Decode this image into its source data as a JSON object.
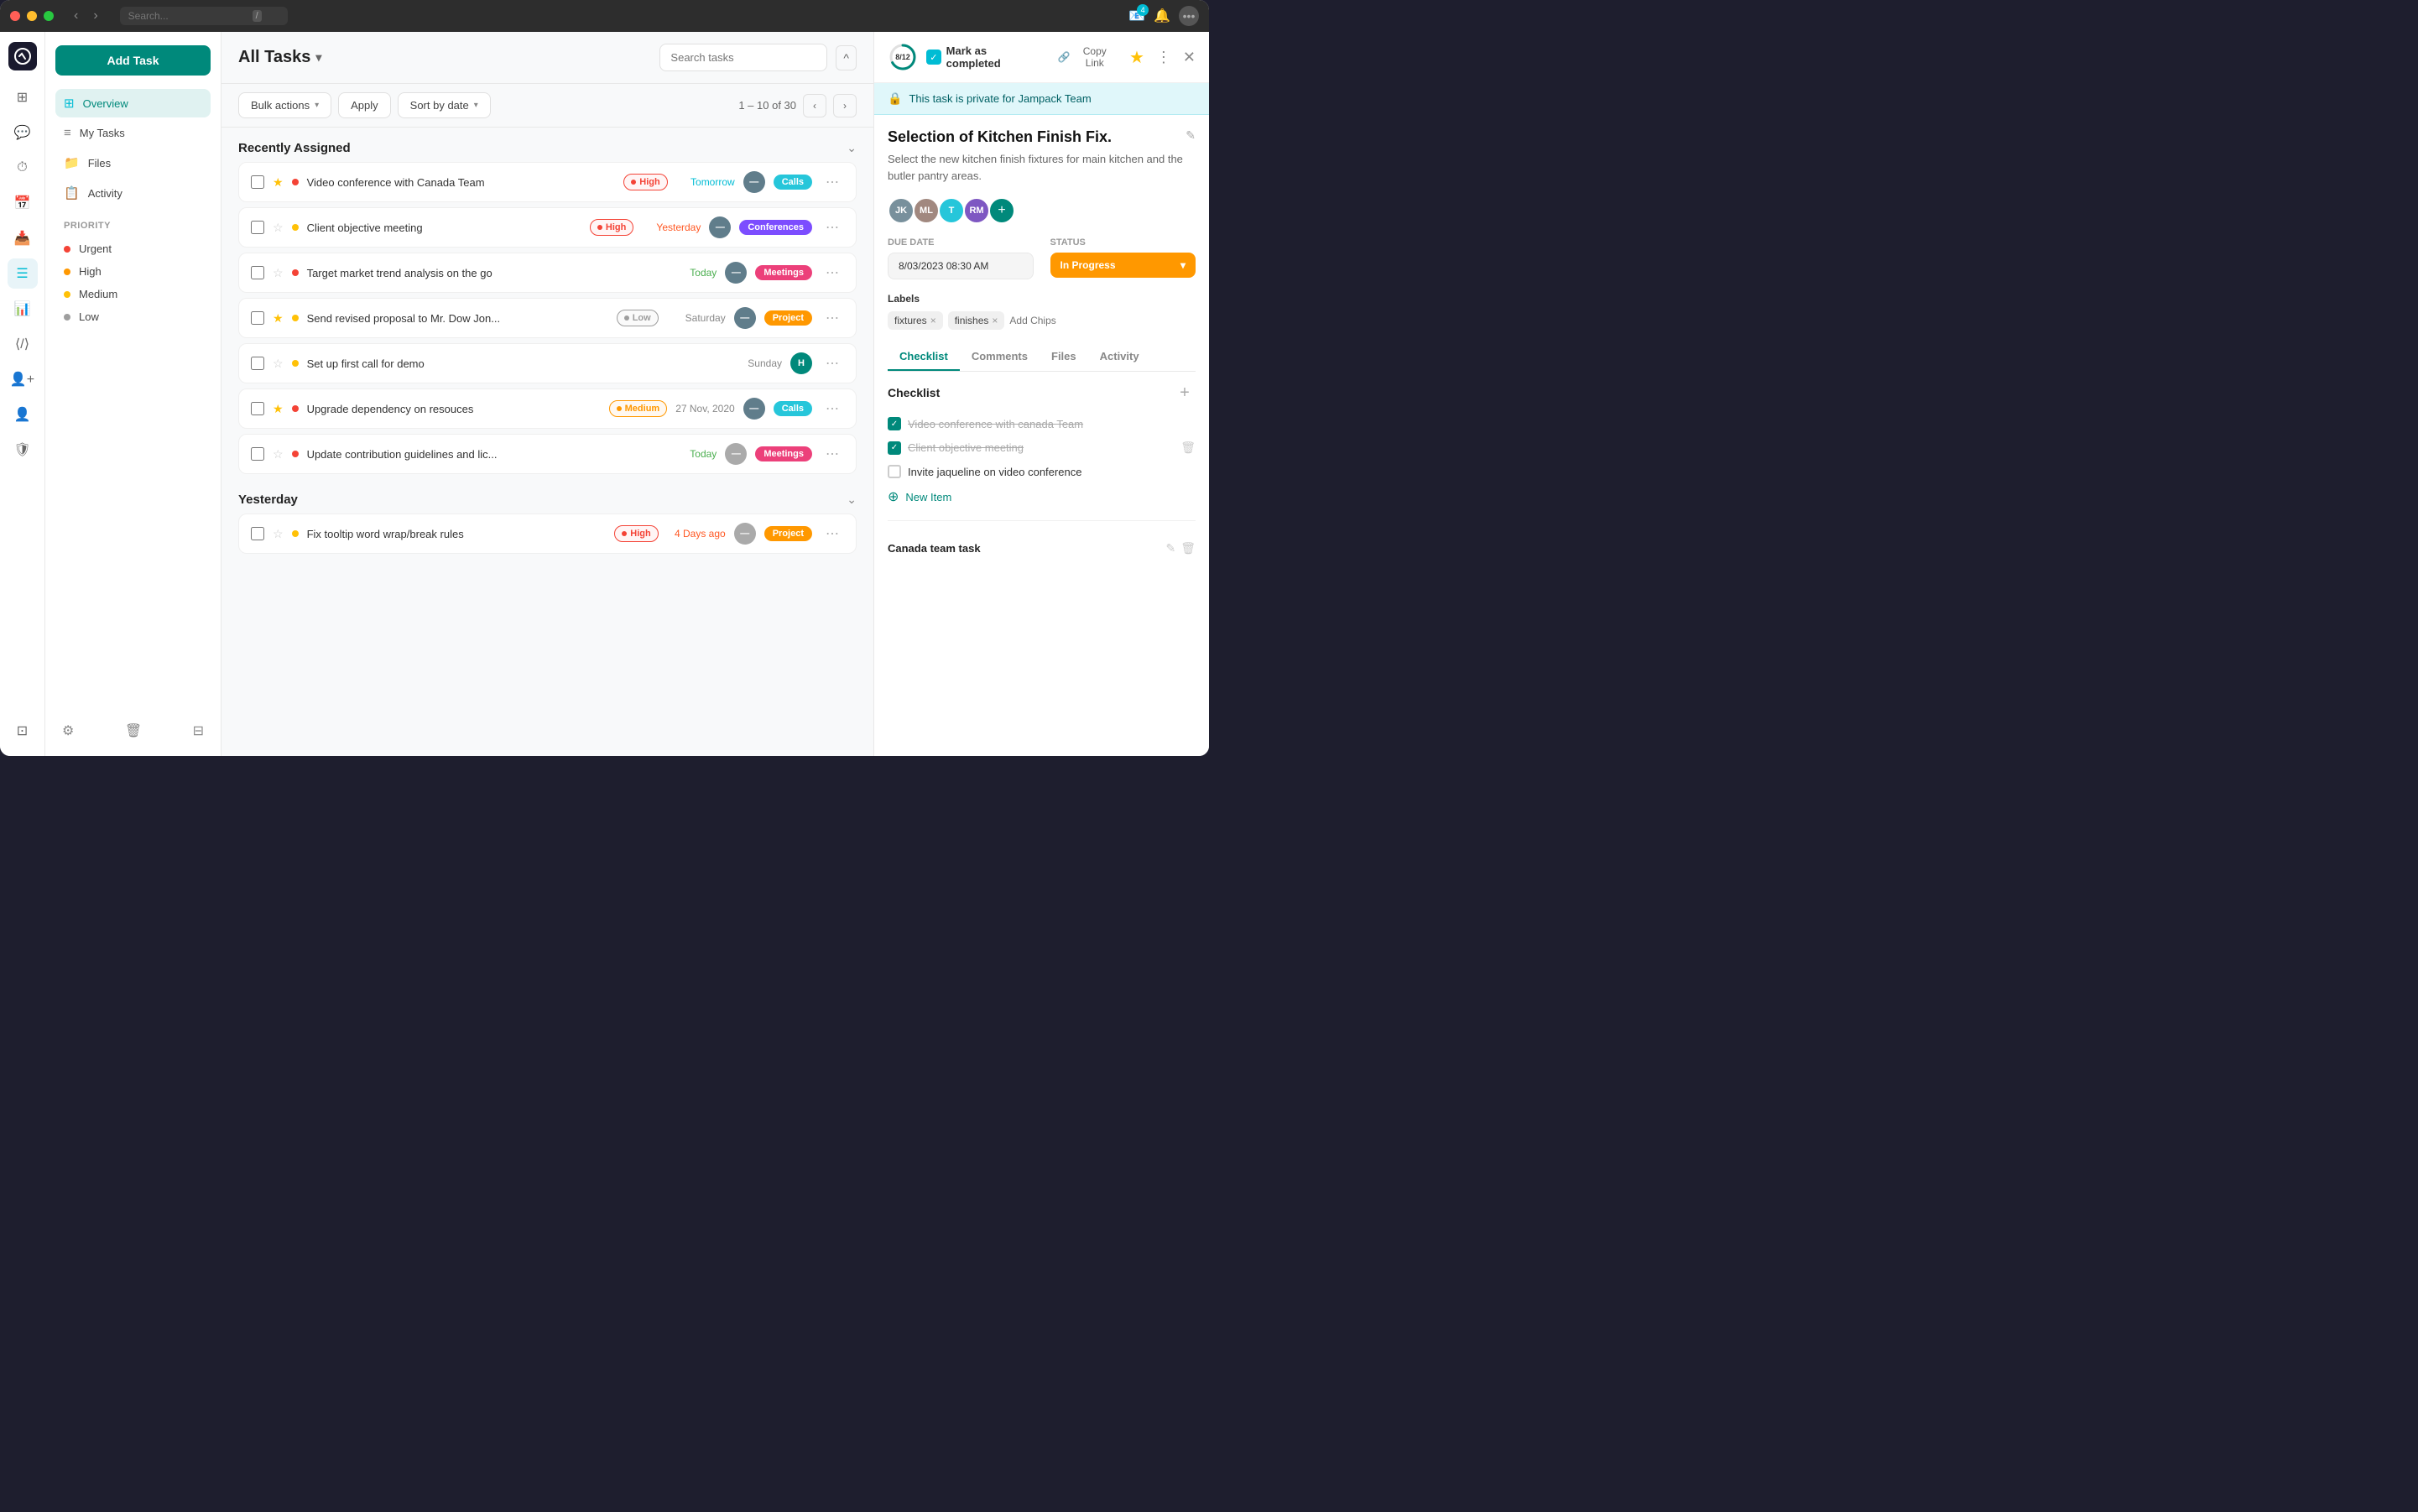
{
  "titlebar": {
    "search_placeholder": "Search...",
    "slash_key": "/",
    "nav_back": "‹",
    "nav_forward": "›"
  },
  "header": {
    "notification_count": "4",
    "page_title": "All Tasks",
    "search_placeholder": "Search tasks",
    "collapse_label": "⌃"
  },
  "toolbar": {
    "bulk_actions": "Bulk actions",
    "apply": "Apply",
    "sort_by_date": "Sort by date",
    "pagination_label": "1 – 10 of 30"
  },
  "sidebar": {
    "add_task": "Add Task",
    "nav_items": [
      {
        "id": "overview",
        "label": "Overview",
        "icon": "⊞",
        "active": true
      },
      {
        "id": "my-tasks",
        "label": "My Tasks",
        "icon": "≡"
      },
      {
        "id": "files",
        "label": "Files",
        "icon": "📁"
      },
      {
        "id": "activity",
        "label": "Activity",
        "icon": "📋"
      }
    ],
    "priority_section": "Priority",
    "priorities": [
      {
        "id": "urgent",
        "label": "Urgent",
        "color": "urgent"
      },
      {
        "id": "high",
        "label": "High",
        "color": "high"
      },
      {
        "id": "medium",
        "label": "Medium",
        "color": "medium"
      },
      {
        "id": "low",
        "label": "Low",
        "color": "low"
      }
    ]
  },
  "task_groups": [
    {
      "id": "recently-assigned",
      "title": "Recently Assigned",
      "tasks": [
        {
          "id": "t1",
          "name": "Video conference with Canada Team",
          "priority": "high",
          "priority_label": "High",
          "date": "Tomorrow",
          "date_class": "tomorrow",
          "tag": "Calls",
          "tag_class": "tag-calls",
          "starred": true,
          "show_avatar": false
        },
        {
          "id": "t2",
          "name": "Client objective meeting",
          "priority": "high",
          "priority_label": "High",
          "date": "Yesterday",
          "date_class": "yesterday",
          "tag": "Conferences",
          "tag_class": "tag-conferences",
          "starred": false,
          "show_avatar": false
        },
        {
          "id": "t3",
          "name": "Target market trend analysis on the go",
          "priority": "urgent",
          "priority_label": "",
          "date": "Today",
          "date_class": "today",
          "tag": "Meetings",
          "tag_class": "tag-meetings",
          "starred": false,
          "show_avatar": false
        },
        {
          "id": "t4",
          "name": "Send revised proposal to Mr. Dow Jon...",
          "priority": "low",
          "priority_label": "Low",
          "date": "Saturday",
          "date_class": "",
          "tag": "Project",
          "tag_class": "tag-project",
          "starred": true,
          "show_avatar": false
        },
        {
          "id": "t5",
          "name": "Set up first call for demo",
          "priority": "medium",
          "priority_label": "",
          "date": "Sunday",
          "date_class": "",
          "tag": "",
          "tag_class": "",
          "starred": false,
          "show_avatar": true,
          "avatar_text": "H",
          "avatar_class": "teal"
        },
        {
          "id": "t6",
          "name": "Upgrade dependency on resouces",
          "priority": "medium",
          "priority_label": "Medium",
          "date": "27 Nov, 2020",
          "date_class": "",
          "tag": "Calls",
          "tag_class": "tag-calls",
          "starred": true,
          "show_avatar": false
        },
        {
          "id": "t7",
          "name": "Update contribution guidelines and lic...",
          "priority": "urgent",
          "priority_label": "",
          "date": "Today",
          "date_class": "today",
          "tag": "Meetings",
          "tag_class": "tag-meetings",
          "starred": false,
          "show_avatar": false
        }
      ]
    },
    {
      "id": "yesterday",
      "title": "Yesterday",
      "tasks": [
        {
          "id": "t8",
          "name": "Fix tooltip word wrap/break rules",
          "priority": "high",
          "priority_label": "High",
          "date": "4 Days ago",
          "date_class": "daysago",
          "tag": "Project",
          "tag_class": "tag-project",
          "starred": false,
          "show_avatar": false
        }
      ]
    }
  ],
  "detail_panel": {
    "progress": "8/12",
    "progress_value": 67,
    "mark_complete_label": "Mark as completed",
    "copy_link_label": "Copy Link",
    "private_banner": "This task is private for Jampack Team",
    "title": "Selection of Kitchen Finish Fix.",
    "description": "Select the new kitchen finish fixtures for main kitchen and the butler pantry areas.",
    "due_date_label": "Due Date",
    "due_date_value": "8/03/2023 08:30 AM",
    "status_label": "Status",
    "status_value": "In Progress",
    "labels_label": "Labels",
    "labels": [
      {
        "text": "fixtures"
      },
      {
        "text": "finishes"
      }
    ],
    "add_chips_placeholder": "Add Chips",
    "tabs": [
      {
        "id": "checklist",
        "label": "Checklist",
        "active": true
      },
      {
        "id": "comments",
        "label": "Comments"
      },
      {
        "id": "files",
        "label": "Files"
      },
      {
        "id": "activity",
        "label": "Activity"
      }
    ],
    "checklist_title": "Checklist",
    "checklist_items": [
      {
        "text": "Video conference with canada Team",
        "checked": true
      },
      {
        "text": "Client objective meeting",
        "checked": true
      },
      {
        "text": "Invite jaqueline on video conference",
        "checked": false
      }
    ],
    "new_item_label": "New Item",
    "canada_section_title": "Canada team task"
  }
}
